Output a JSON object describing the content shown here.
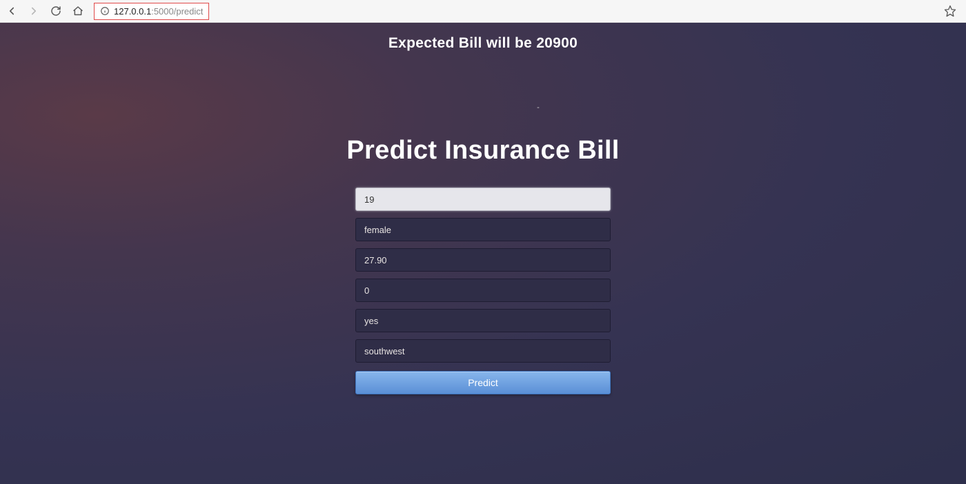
{
  "browser": {
    "url_host": "127.0.0.1",
    "url_port_path": ":5000/predict"
  },
  "page": {
    "expected_bill_text": "Expected Bill will be 20900",
    "dash": "-",
    "title": "Predict Insurance Bill"
  },
  "form": {
    "inputs": [
      {
        "value": "19",
        "focused": true
      },
      {
        "value": "female",
        "focused": false
      },
      {
        "value": "27.90",
        "focused": false
      },
      {
        "value": "0",
        "focused": false
      },
      {
        "value": "yes",
        "focused": false
      },
      {
        "value": "southwest",
        "focused": false
      }
    ],
    "submit_label": "Predict"
  }
}
